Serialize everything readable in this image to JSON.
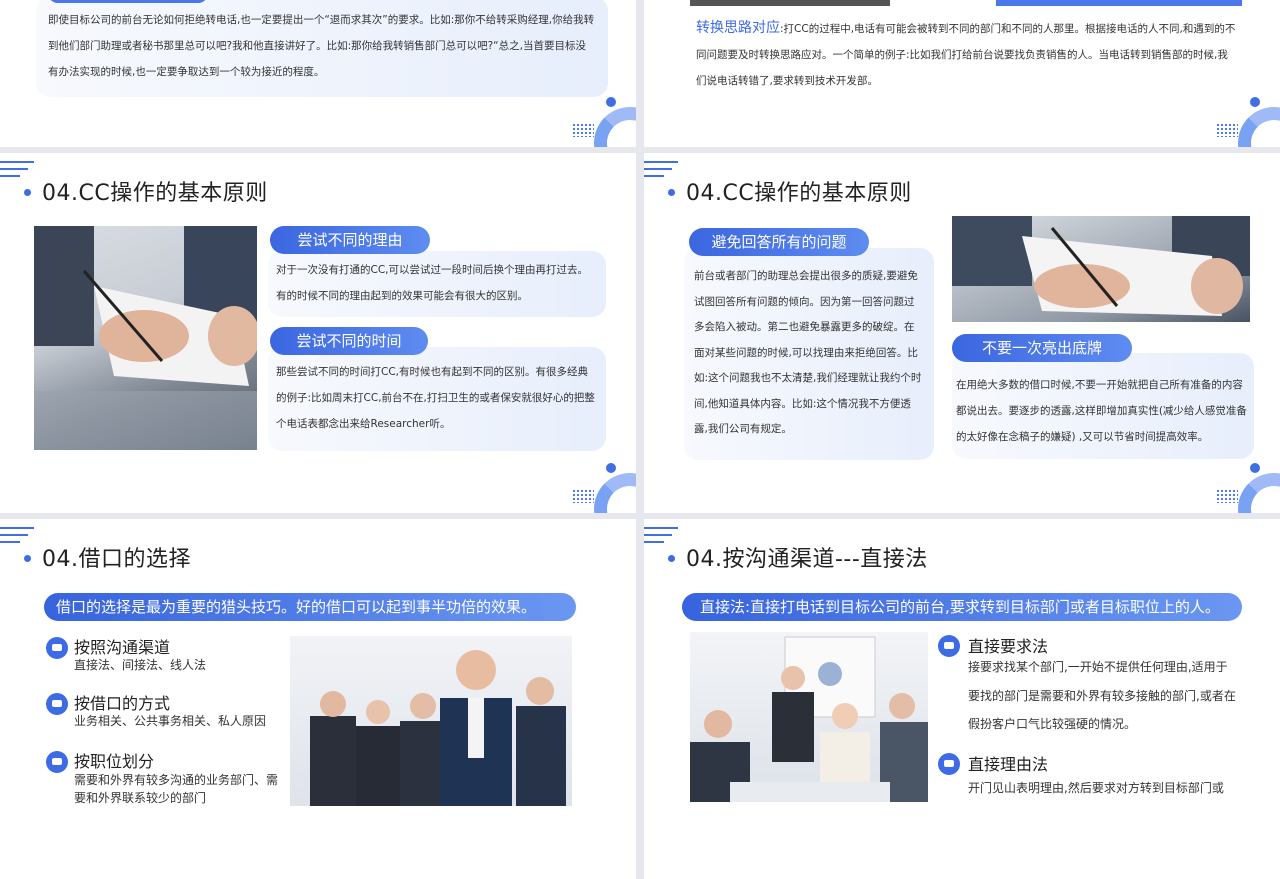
{
  "top_left": {
    "text": "即使目标公司的前台无论如何拒绝转电话,也一定要提出一个“退而求其次”的要求。比如:那你不给转采购经理,你给我转到他们部门助理或者秘书那里总可以吧?我和他直接讲好了。比如:那你给我转销售部门总可以吧?“总之,当首要目标没有办法实现的时候,也一定要争取达到一个较为接近的程度。"
  },
  "top_right": {
    "highlight": "转换思路对应",
    "text": ":打CC的过程中,电话有可能会被转到不同的部门和不同的人那里。根据接电话的人不同,和遇到的不同问题要及时转换思路应对。一个简单的例子:比如我们打给前台说要找负责销售的人。当电话转到销售部的时候,我们说电话转错了,要求转到技术开发部。"
  },
  "mid_left": {
    "title": "04.CC操作的基本原则",
    "pill1": "尝试不同的理由",
    "text1": "对于一次没有打通的CC,可以尝试过一段时间后换个理由再打过去。有的时候不同的理由起到的效果可能会有很大的区别。",
    "pill2": "尝试不同的时间",
    "text2": "那些尝试不同的时间打CC,有时候也有起到不同的区别。有很多经典的例子:比如周末打CC,前台不在,打扫卫生的或者保安就很好心的把整个电话表都念出来给Researcher听。"
  },
  "mid_right": {
    "title": "04.CC操作的基本原则",
    "pill1": "避免回答所有的问题",
    "text1": "前台或者部门的助理总会提出很多的质疑,要避免试图回答所有问题的倾向。因为第一回答问题过多会陷入被动。第二也避免暴露更多的破绽。在面对某些问题的时候,可以找理由来拒绝回答。比如:这个问题我也不太清楚,我们经理就让我约个时间,他知道具体内容。比如:这个情况我不方便透露,我们公司有规定。",
    "pill2": "不要一次亮出底牌",
    "text2": "在用绝大多数的借口时候,不要一开始就把自己所有准备的内容都说出去。要逐步的透露,这样即增加真实性(减少给人感觉准备的太好像在念稿子的嫌疑) ,又可以节省时间提高效率。"
  },
  "bot_left": {
    "title": "04.借口的选择",
    "banner": "借口的选择是最为重要的猎头技巧。好的借口可以起到事半功倍的效果。",
    "items": [
      {
        "h": "按照沟通渠道",
        "d": "直接法、间接法、线人法"
      },
      {
        "h": "按借口的方式",
        "d": "业务相关、公共事务相关、私人原因"
      },
      {
        "h": "按职位划分",
        "d": "需要和外界有较多沟通的业务部门、需要和外界联系较少的部门"
      }
    ]
  },
  "bot_right": {
    "title": "04.按沟通渠道---直接法",
    "banner": "直接法:直接打电话到目标公司的前台,要求转到目标部门或者目标职位上的人。",
    "items": [
      {
        "h": "直接要求法",
        "d": "接要求找某个部门,一开始不提供任何理由,适用于要找的部门是需要和外界有较多接触的部门,或者在假扮客户口气比较强硬的情况。"
      },
      {
        "h": "直接理由法",
        "d": "开门见山表明理由,然后要求对方转到目标部门或"
      }
    ]
  },
  "colors": {
    "accent": "#3d6be6"
  }
}
